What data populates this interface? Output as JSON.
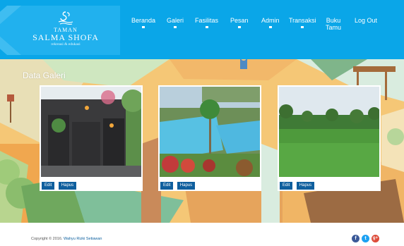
{
  "colors": {
    "header_bg": "#0aa6e8",
    "button_bg": "#0f5f9e",
    "facebook": "#3b5998",
    "twitter": "#1da1f2",
    "googleplus": "#dd4b39"
  },
  "brand": {
    "line1": "TAMAN",
    "line2": "SALMA SHOFA",
    "line3": "rekreasi & edukasi",
    "emblem_icon": "swan-emblem-icon"
  },
  "nav": {
    "items": [
      {
        "label": "Beranda",
        "sub": ""
      },
      {
        "label": "Galeri",
        "sub": ""
      },
      {
        "label": "Fasilitas",
        "sub": ""
      },
      {
        "label": "Pesan",
        "sub": ""
      },
      {
        "label": "Admin",
        "sub": ""
      },
      {
        "label": "Transaksi",
        "sub": ""
      },
      {
        "label": "Buku",
        "sub": "Tamu"
      },
      {
        "label": "Log Out",
        "sub": ""
      }
    ]
  },
  "gallery": {
    "title": "Data Galeri",
    "items": [
      {
        "edit_label": "Edit",
        "delete_label": "Hapus"
      },
      {
        "edit_label": "Edit",
        "delete_label": "Hapus"
      },
      {
        "edit_label": "Edit",
        "delete_label": "Hapus"
      }
    ]
  },
  "footer": {
    "copyright_prefix": "Copyright © 2016.",
    "author": "Wahyu Rizki Setiawan",
    "social": [
      {
        "icon": "facebook-icon",
        "glyph": "f"
      },
      {
        "icon": "twitter-icon",
        "glyph": "t"
      },
      {
        "icon": "googleplus-icon",
        "glyph": "g+"
      }
    ]
  }
}
